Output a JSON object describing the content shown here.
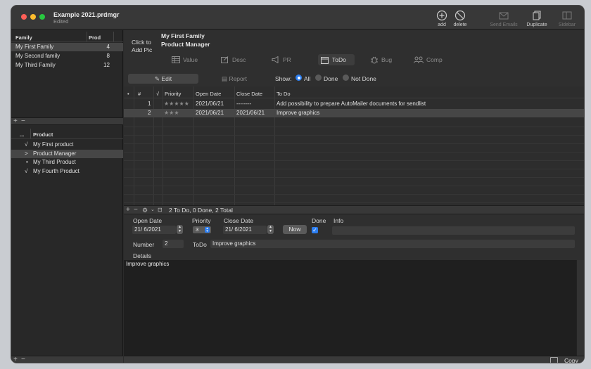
{
  "window": {
    "title": "Example 2021.prdmgr",
    "subtitle": "Edited"
  },
  "toolbar": [
    {
      "label": "add",
      "icon": "plus-circle-icon"
    },
    {
      "label": "delete",
      "icon": "no-entry-icon"
    },
    {
      "label": "Send Emails",
      "icon": "envelope-icon"
    },
    {
      "label": "Duplicate",
      "icon": "duplicate-icon"
    },
    {
      "label": "Sidebar",
      "icon": "sidebar-icon"
    }
  ],
  "families": {
    "header": {
      "name": "Family",
      "count": "Prod"
    },
    "rows": [
      {
        "name": "My First Family",
        "count": "4"
      },
      {
        "name": "My Second family",
        "count": "8"
      },
      {
        "name": "My Third Family",
        "count": "12"
      }
    ]
  },
  "products": {
    "header": {
      "marker": "...",
      "name": "Product"
    },
    "rows": [
      {
        "marker": "√",
        "name": "My First product"
      },
      {
        "marker": ">",
        "name": "Product Manager"
      },
      {
        "marker": "•",
        "name": "My Third Product"
      },
      {
        "marker": "√",
        "name": "My Fourth Product"
      }
    ]
  },
  "header": {
    "click_pic": "Click to\nAdd Pic",
    "family": "My First Family",
    "product": "Product Manager"
  },
  "tabs": [
    "Value",
    "Desc",
    "PR",
    "ToDo",
    "Bug",
    "Comp"
  ],
  "mode": {
    "edit": "Edit",
    "report": "Report",
    "show_label": "Show:",
    "show_options": [
      "All",
      "Done",
      "Not Done"
    ]
  },
  "table": {
    "columns": [
      "•",
      "#",
      "√",
      "Priority",
      "Open Date",
      "Close Date",
      "To Do"
    ],
    "rows": [
      {
        "num": "1",
        "stars": "★★★★★",
        "open": "2021/06/21",
        "close": "--------",
        "todo": "Add possibility to prepare AutoMailer documents for sendlist"
      },
      {
        "num": "2",
        "stars": "★★★",
        "open": "2021/06/21",
        "close": "2021/06/21",
        "todo": "Improve graphics"
      }
    ]
  },
  "status": "2 To Do, 0 Done, 2 Total",
  "detail": {
    "open_date_label": "Open Date",
    "open_date": "21/ 6/2021",
    "priority_label": "Priority",
    "priority": "3",
    "close_date_label": "Close Date",
    "close_date": "21/ 6/2021",
    "now": "Now",
    "done_label": "Done",
    "info_label": "Info",
    "number_label": "Number",
    "number": "2",
    "todo_label": "ToDo",
    "todo": "Improve graphics",
    "details_label": "Details",
    "details_text": "Improve graphics"
  },
  "copy_label": "Copy"
}
